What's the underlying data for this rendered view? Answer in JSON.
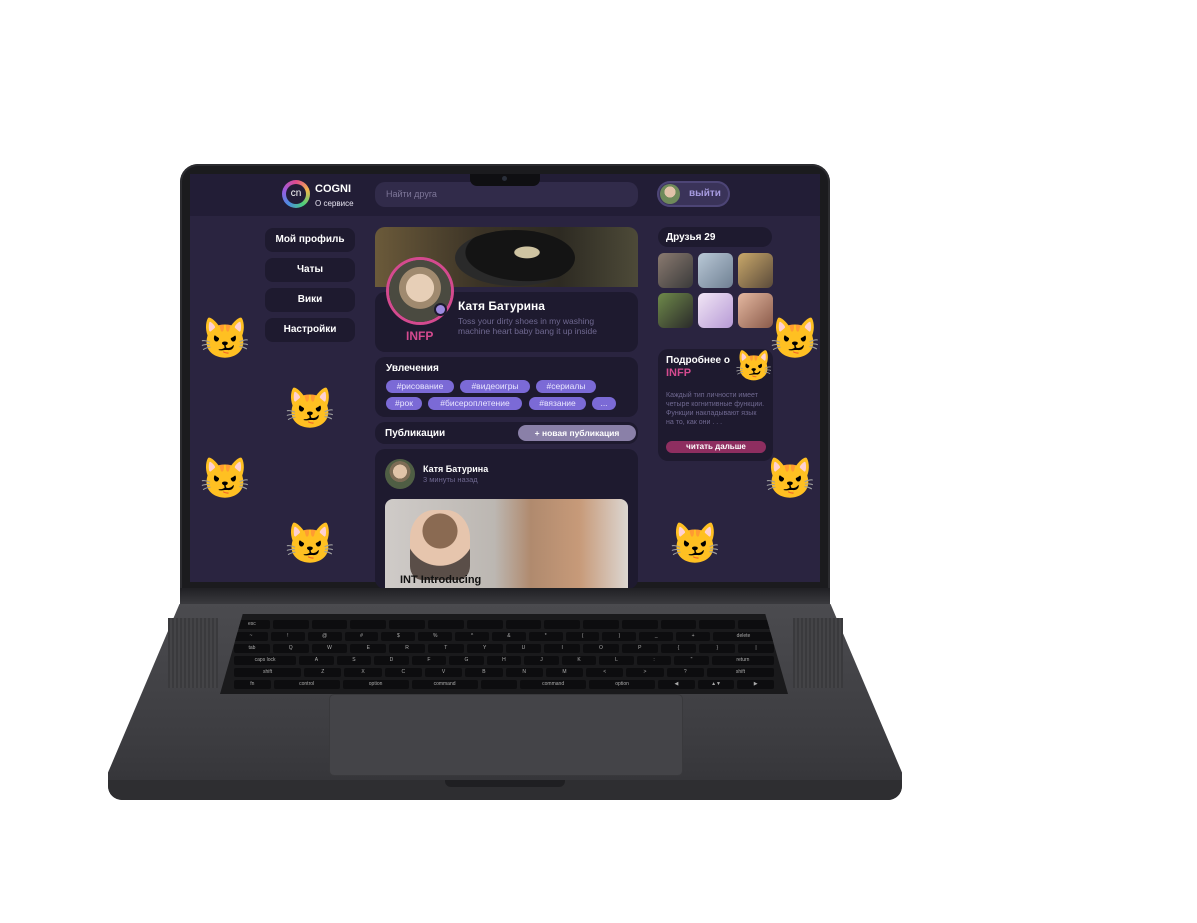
{
  "header": {
    "brand": "COGNI",
    "logo_text": "cn",
    "about_link": "О сервисе",
    "search_placeholder": "Найти друга",
    "logout_label": "выйти"
  },
  "nav": {
    "items": [
      {
        "label": "Мой профиль"
      },
      {
        "label": "Чаты"
      },
      {
        "label": "Вики"
      },
      {
        "label": "Настройки"
      }
    ]
  },
  "profile": {
    "name": "Катя Батурина",
    "bio": "Toss your dirty shoes in my washing machine heart baby bang it up inside",
    "type_badge": "INFP"
  },
  "hobbies": {
    "title": "Увлечения",
    "tags": [
      "#рисование",
      "#видеоигры",
      "#сериалы",
      "#рок",
      "#бисероплетение",
      "#вязание",
      "..."
    ]
  },
  "publications": {
    "title": "Публикации",
    "new_button": "+ новая публикация",
    "post": {
      "author": "Катя Батурина",
      "time": "3 минуты назад",
      "caption": "INT Introducing"
    }
  },
  "friends": {
    "title": "Друзья 29"
  },
  "about_type": {
    "title": "Подробнее  о",
    "type": "INFP",
    "text": "Каждый тип личности имеет четыре когнитивные функции. Функции накладывают язык на то, как они . . .",
    "read_more": "читать дальше"
  },
  "keyboard": {
    "rows": [
      [
        "esc",
        "",
        "",
        "",
        "",
        "",
        "",
        "",
        "",
        "",
        "",
        "",
        "",
        ""
      ],
      [
        "~",
        "!",
        "@",
        "#",
        "$",
        "%",
        "^",
        "&",
        "*",
        "(",
        ")",
        "_",
        "+",
        "delete"
      ],
      [
        "tab",
        "Q",
        "W",
        "E",
        "R",
        "T",
        "Y",
        "U",
        "I",
        "O",
        "P",
        "{",
        "}",
        "|"
      ],
      [
        "caps lock",
        "A",
        "S",
        "D",
        "F",
        "G",
        "H",
        "J",
        "K",
        "L",
        ":",
        "\"",
        "return"
      ],
      [
        "shift",
        "Z",
        "X",
        "C",
        "V",
        "B",
        "N",
        "M",
        "<",
        ">",
        "?",
        "shift"
      ],
      [
        "fn",
        "control",
        "option",
        "command",
        "",
        "command",
        "option",
        "◀",
        "▲▼",
        "▶"
      ]
    ]
  },
  "colors": {
    "background": "#2a2440",
    "card": "#1e1a2f",
    "accent_pink": "#d44a8f",
    "tag_purple": "#7b6ad6"
  }
}
